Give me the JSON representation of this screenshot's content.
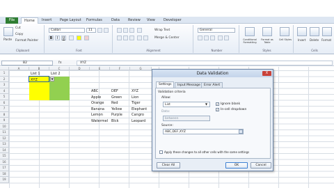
{
  "ribbon": {
    "tabs": [
      "File",
      "Home",
      "Insert",
      "Page Layout",
      "Formulas",
      "Data",
      "Review",
      "View",
      "Developer"
    ],
    "clipboard": {
      "paste": "Paste",
      "cut": "Cut",
      "copy": "Copy",
      "format_painter": "Format Painter",
      "group": "Clipboard"
    },
    "font": {
      "name": "Calibri",
      "size": "11",
      "group": "Font"
    },
    "alignment": {
      "wrap": "Wrap Text",
      "merge": "Merge & Center",
      "group": "Alignment"
    },
    "number": {
      "format": "General",
      "group": "Number"
    },
    "styles": {
      "conditional": "Conditional Formatting",
      "format_table": "Format as Table",
      "cell_styles": "Cell Styles",
      "group": "Styles"
    },
    "cells": {
      "insert": "Insert",
      "delete": "Delete",
      "format": "Format",
      "group": "Cells"
    }
  },
  "formula_bar": {
    "name_box": "B2",
    "fx": "fx",
    "content": "XYZ"
  },
  "sheet": {
    "columns": [
      "A",
      "B",
      "C",
      "D",
      "E",
      "F",
      "G"
    ],
    "rows": [
      "1",
      "2",
      "3",
      "4",
      "5",
      "6",
      "7",
      "8",
      "9",
      "10",
      "11",
      "12",
      "13",
      "14",
      "15",
      "16",
      "17",
      "18",
      "19"
    ],
    "b1": "List 1",
    "c1": "List 2",
    "b2": "XYZ",
    "headers": [
      "ABC",
      "DEF",
      "XYZ"
    ],
    "table": [
      [
        "Apple",
        "Green",
        "Lion"
      ],
      [
        "Orange",
        "Red",
        "Tiger"
      ],
      [
        "Banana",
        "Yellow",
        "Elephant"
      ],
      [
        "Lemon",
        "Purple",
        "Cangro"
      ],
      [
        "Watermel",
        "Blck",
        "Leopard"
      ]
    ]
  },
  "dialog": {
    "title": "Data Validation",
    "close": "X",
    "tabs": [
      "Settings",
      "Input Message",
      "Error Alert"
    ],
    "criteria": "Validation criteria",
    "allow_label": "Allow:",
    "allow_value": "List",
    "data_label": "Data:",
    "data_value": "between",
    "ignore_blank": "Ignore blank",
    "in_cell_dropdown": "In-cell dropdown",
    "source_label": "Source:",
    "source_value": "ABC,DEF,XYZ",
    "apply_all": "Apply these changes to all other cells with the same settings",
    "clear_all": "Clear All",
    "ok": "OK",
    "cancel": "Cancel"
  },
  "colors": {
    "yellow": "#ffff00",
    "green": "#92d050",
    "file_tab": "#2f7d32"
  }
}
